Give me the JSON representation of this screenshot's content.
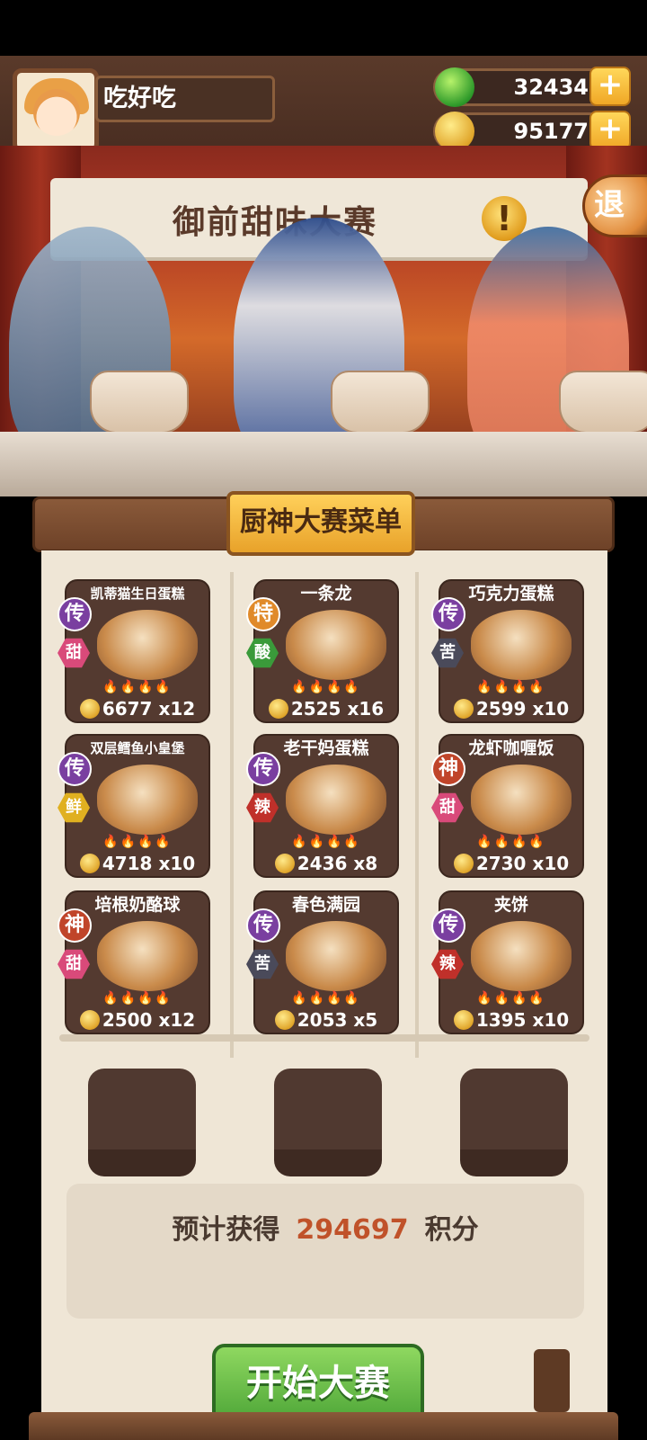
{
  "player": {
    "name": "吃好吃"
  },
  "currencies": {
    "gems": "32434",
    "coins": "95177"
  },
  "icons": {
    "gem": "green-gem-icon",
    "coin": "gold-coin-icon",
    "plus": "plus-icon",
    "alert": "exclamation-icon"
  },
  "event": {
    "title": "御前甜味大赛",
    "alert_symbol": "!",
    "exit_label": "退"
  },
  "menu": {
    "title": "厨神大赛菜单",
    "dishes": [
      {
        "name": "凯蒂猫生日蛋糕",
        "rarity": "传",
        "flavor": "甜",
        "price": "6677",
        "qty": "x12"
      },
      {
        "name": "一条龙",
        "rarity": "特",
        "flavor": "酸",
        "price": "2525",
        "qty": "x16"
      },
      {
        "name": "巧克力蛋糕",
        "rarity": "传",
        "flavor": "苦",
        "price": "2599",
        "qty": "x10"
      },
      {
        "name": "双层鳕鱼小皇堡",
        "rarity": "传",
        "flavor": "鲜",
        "price": "4718",
        "qty": "x10"
      },
      {
        "name": "老干妈蛋糕",
        "rarity": "传",
        "flavor": "辣",
        "price": "2436",
        "qty": "x8"
      },
      {
        "name": "龙虾咖喱饭",
        "rarity": "神",
        "flavor": "甜",
        "price": "2730",
        "qty": "x10"
      },
      {
        "name": "培根奶酪球",
        "rarity": "神",
        "flavor": "甜",
        "price": "2500",
        "qty": "x12"
      },
      {
        "name": "春色满园",
        "rarity": "传",
        "flavor": "苦",
        "price": "2053",
        "qty": "x5"
      },
      {
        "name": "夹饼",
        "rarity": "传",
        "flavor": "辣",
        "price": "1395",
        "qty": "x10"
      }
    ]
  },
  "estimate": {
    "prefix": "预计获得",
    "value": "294697",
    "suffix": "积分"
  },
  "start_button": "开始大赛",
  "colors": {
    "rarity_chuan": "#7a3fa0",
    "rarity_te": "#e08a2a",
    "rarity_shen": "#c0452a",
    "flavor_sweet": "#d94a7a",
    "flavor_sour": "#3a9a3a",
    "flavor_bitter": "#4a4a5a",
    "flavor_fresh": "#e0b020",
    "flavor_spicy": "#c0302a",
    "score_value": "#c0522a"
  }
}
